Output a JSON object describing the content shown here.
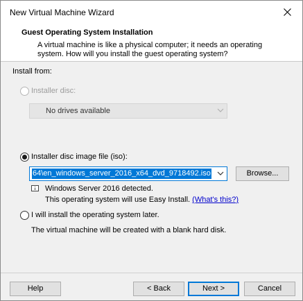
{
  "window": {
    "title": "New Virtual Machine Wizard"
  },
  "header": {
    "title": "Guest Operating System Installation",
    "description": "A virtual machine is like a physical computer; it needs an operating system. How will you install the guest operating system?"
  },
  "install_from": {
    "label": "Install from:",
    "installer_disc": {
      "label": "Installer disc:",
      "selected": false,
      "enabled": false,
      "dropdown_value": "No drives available"
    },
    "iso_image": {
      "label": "Installer disc image file (iso):",
      "selected": true,
      "path_value": "64\\en_windows_server_2016_x64_dvd_9718492.iso",
      "browse_label": "Browse...",
      "status_line1": "Windows Server 2016 detected.",
      "status_line2": "This operating system will use Easy Install.",
      "link_label": "(What's this?)"
    },
    "install_later": {
      "label": "I will install the operating system later.",
      "selected": false,
      "description": "The virtual machine will be created with a blank hard disk."
    }
  },
  "footer": {
    "help_label": "Help",
    "back_label": "< Back",
    "next_label": "Next >",
    "cancel_label": "Cancel"
  },
  "colors": {
    "accent": "#0078d7",
    "link": "#0000cc",
    "window_bg": "#f0f0f0"
  }
}
